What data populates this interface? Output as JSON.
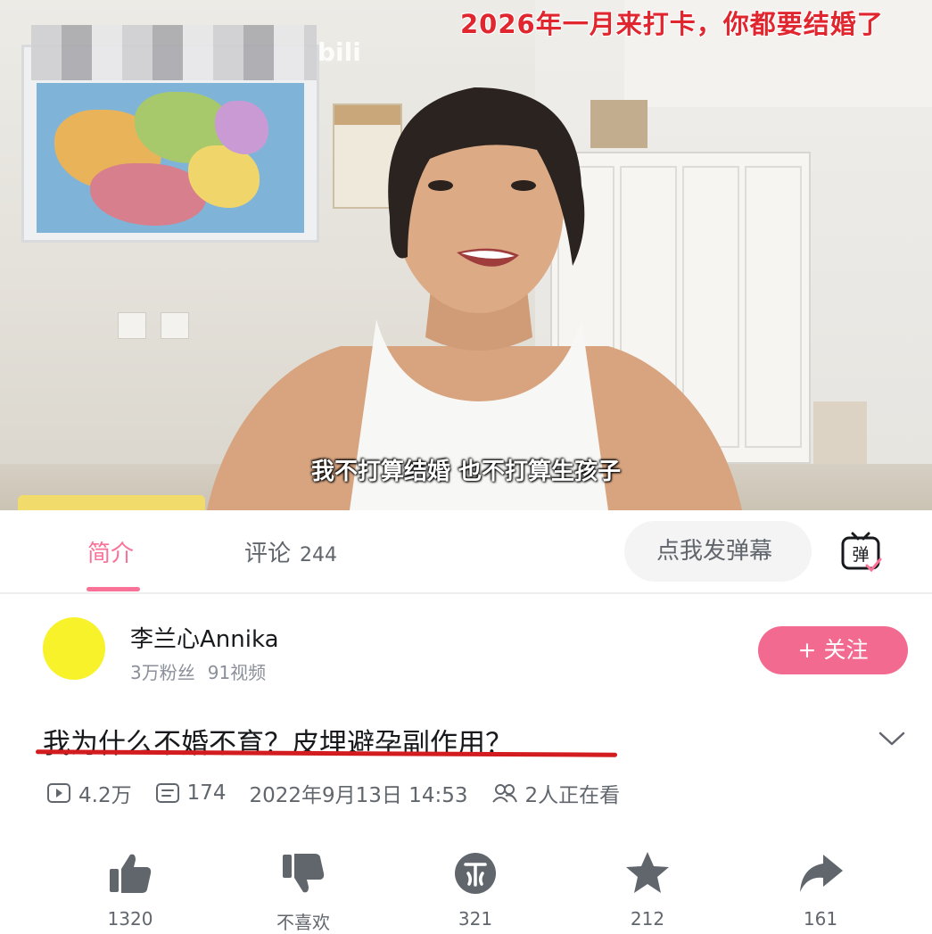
{
  "video": {
    "top_banner": "2026年一月来打卡，你都要结婚了",
    "subtitle": "我不打算结婚  也不打算生孩子",
    "watermark": "bili"
  },
  "tabs": {
    "intro_label": "简介",
    "comments_label": "评论",
    "comments_count": "244",
    "danmaku_placeholder": "点我发弹幕",
    "danmaku_toggle_glyph": "弹"
  },
  "uploader": {
    "name": "李兰心Annika",
    "fans": "3万粉丝",
    "videos": "91视频",
    "follow_label": "+ 关注",
    "avatar_color": "#f8f22a"
  },
  "video_info": {
    "title": "我为什么不婚不育？皮埋避孕副作用？",
    "views": "4.2万",
    "danmaku_count": "174",
    "publish_date": "2022年9月13日 14:53",
    "watching": "2人正在看"
  },
  "actions": {
    "like_count": "1320",
    "dislike_label": "不喜欢",
    "coin_count": "321",
    "favorite_count": "212",
    "share_count": "161"
  },
  "colors": {
    "accent_pink": "#fb7299",
    "follow_button": "#f36a90",
    "banner_red": "#e0262f",
    "title_underline": "#d21c20"
  }
}
